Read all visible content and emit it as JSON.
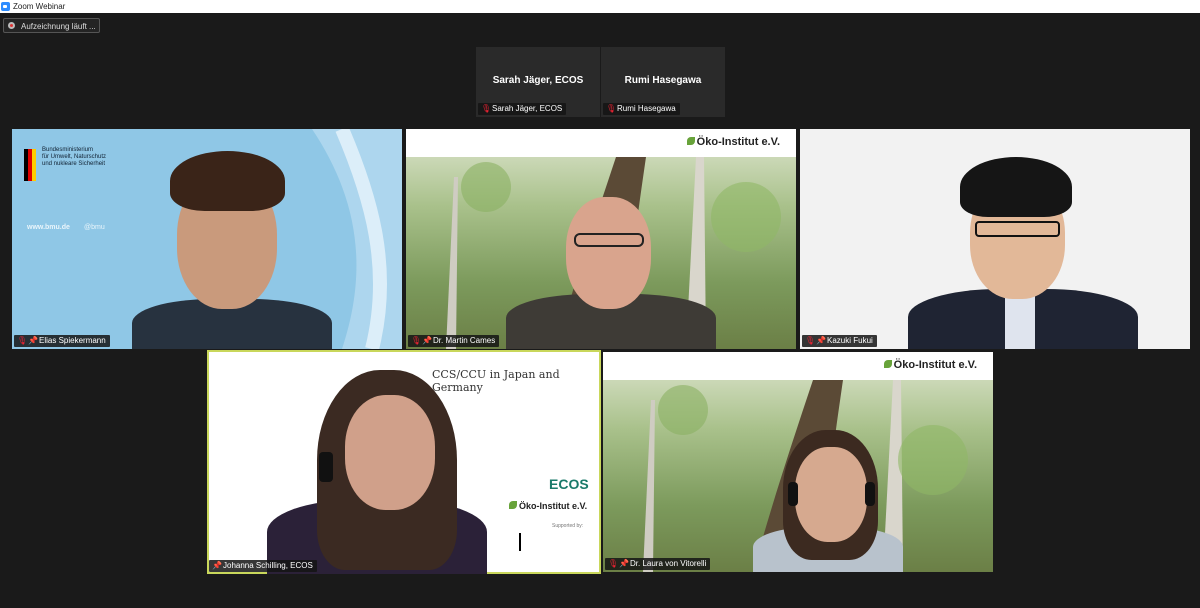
{
  "window": {
    "title": "Zoom Webinar"
  },
  "recording": {
    "label": "Aufzeichnung läuft ..."
  },
  "name_tiles": [
    {
      "display_name": "Sarah Jäger, ECOS",
      "label": "Sarah Jäger, ECOS"
    },
    {
      "display_name": "Rumi Hasegawa",
      "label": "Rumi Hasegawa"
    }
  ],
  "video_tiles": [
    {
      "label": "Elias Spiekermann"
    },
    {
      "label": "Dr. Martin Cames"
    },
    {
      "label": "Kazuki Fukui"
    },
    {
      "label": "Johanna Schilling, ECOS"
    },
    {
      "label": "Dr. Laura von Vitorelli"
    }
  ],
  "backgrounds": {
    "bmu": {
      "org_lines": [
        "Bundesministerium",
        "für Umwelt, Naturschutz",
        "und nukleare Sicherheit"
      ],
      "web": "www.bmu.de",
      "handle": "@bmu"
    },
    "oko": {
      "brand": "Öko-Institut e.V."
    },
    "slide": {
      "title": "CCS/CCU in Japan and Germany",
      "ecos": "ECOS",
      "brand": "Öko-Institut e.V.",
      "supported": "Supported by:"
    }
  },
  "colors": {
    "active_speaker": "#c9d75b",
    "muted_icon": "#e23"
  }
}
